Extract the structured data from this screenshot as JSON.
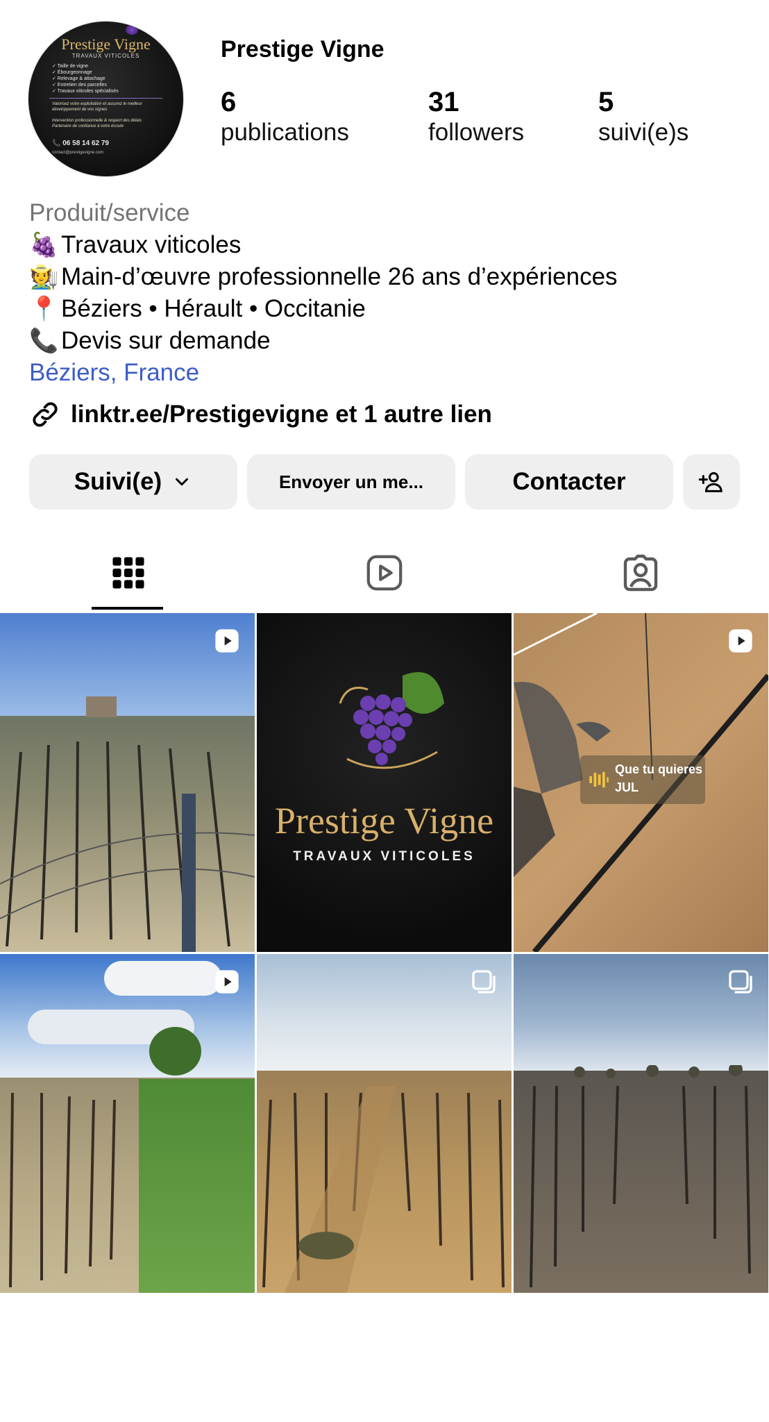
{
  "profile": {
    "username": "Prestige Vigne",
    "avatar": {
      "brand": "Prestige Vigne",
      "tagline": "TRAVAUX VITICOLES",
      "services": [
        "✓ Taille de vigne",
        "✓ Ébourgeonnage",
        "✓ Relevage & attachage",
        "✓ Entretien des parcelles",
        "✓ Travaux viticoles spécialisés"
      ],
      "pitch": "Valorisez votre exploitation et assurez le meilleur développement de vos vignes",
      "notes": [
        "Intervention professionnelle & respect des délais",
        "Partenaire de confiance à votre écoute"
      ],
      "phone": "06 58 14 62 79",
      "email": "contact@prestigevigne.com"
    },
    "stats": [
      {
        "value": "6",
        "label": "publications"
      },
      {
        "value": "31",
        "label": "followers"
      },
      {
        "value": "5",
        "label": "suivi(e)s"
      }
    ]
  },
  "bio": {
    "category": "Produit/service",
    "lines": [
      {
        "emoji": "🍇",
        "text": "Travaux viticoles"
      },
      {
        "emoji": "🧑‍🌾",
        "text": "Main-d’œuvre professionnelle 26 ans d’expériences"
      },
      {
        "emoji": "📍",
        "text": "Béziers • Hérault • Occitanie"
      },
      {
        "emoji": "📞",
        "text": "Devis sur demande"
      }
    ],
    "location": "Béziers, France",
    "link": "linktr.ee/Prestigevigne et 1 autre lien"
  },
  "actions": {
    "follow": "Suivi(e)",
    "message": "Envoyer un me...",
    "contact": "Contacter"
  },
  "tabs": {
    "icons": [
      "grid-icon",
      "reels-icon",
      "tagged-icon"
    ],
    "active": 0
  },
  "posts": [
    {
      "type": "reel",
      "icon": "reel-icon"
    },
    {
      "type": "image",
      "brand_title": "Prestige Vigne",
      "brand_subtitle": "TRAVAUX VITICOLES"
    },
    {
      "type": "reel",
      "icon": "reel-icon",
      "song_line1": "Que tu quieres",
      "song_line2": "JUL"
    },
    {
      "type": "reel",
      "icon": "reel-icon"
    },
    {
      "type": "carousel",
      "icon": "carousel-icon"
    },
    {
      "type": "carousel",
      "icon": "carousel-icon"
    }
  ],
  "colors": {
    "link_blue": "#3d5cc6",
    "category_gray": "#737373",
    "button_bg": "#efefef",
    "brand_gold": "#d8b06a"
  }
}
